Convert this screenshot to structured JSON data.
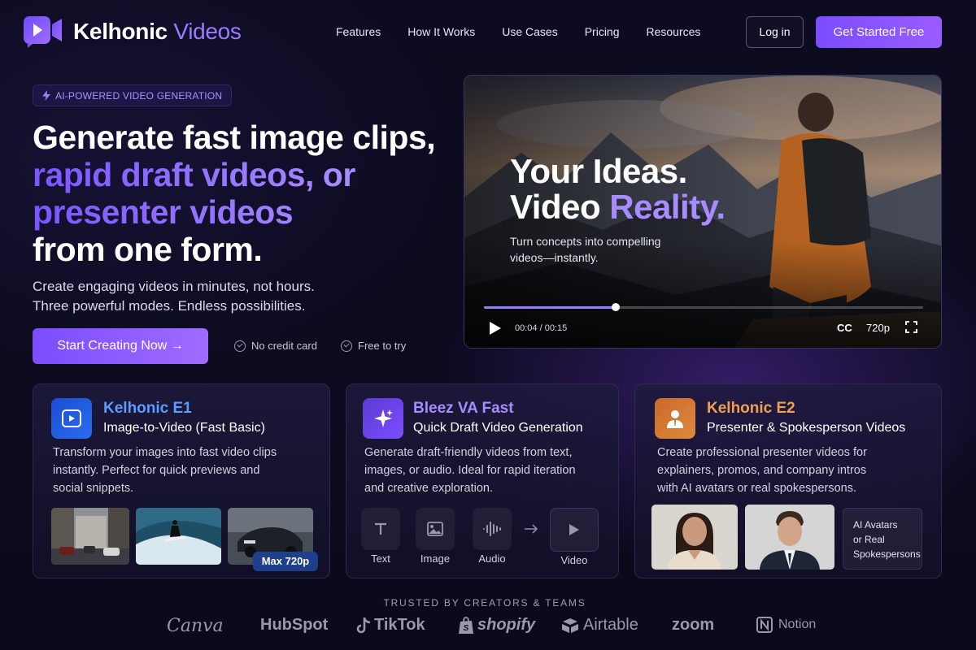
{
  "brand": {
    "name_a": "Kelhonic",
    "name_b": "Videos"
  },
  "nav": {
    "items": [
      "Features",
      "How It Works",
      "Use Cases",
      "Pricing",
      "Resources"
    ],
    "login": "Log in",
    "get_started": "Get Started Free"
  },
  "hero": {
    "badge": "AI-POWERED VIDEO GENERATION",
    "line1": "Generate fast image clips,",
    "line2": "rapid draft videos, or",
    "line3": "presenter videos",
    "line4": "from one form.",
    "sub1": "Create engaging videos in minutes, not hours.",
    "sub2": "Three powerful modes. Endless possibilities.",
    "cta": "Start Creating Now →",
    "check1": "No credit card",
    "check2": "Free to try"
  },
  "video": {
    "head1": "Your Ideas.",
    "head2a": "Video ",
    "head2b": "Reality.",
    "sub1": "Turn concepts into compelling",
    "sub2": "videos—instantly.",
    "time": "00:04 / 00:15",
    "progress": 0.3,
    "cc": "CC",
    "quality": "720p"
  },
  "cards": [
    {
      "name": "Kelhonic E1",
      "tag": "Image-to-Video (Fast Basic)",
      "desc": [
        "Transform your images into fast video clips",
        "instantly. Perfect for quick previews and",
        "social snippets."
      ],
      "max_badge": "Max 720p",
      "icon": "video-square-icon"
    },
    {
      "name": "Bleez VA Fast",
      "tag": "Quick Draft Video Generation",
      "desc": [
        "Generate draft-friendly videos from text,",
        "images, or audio. Ideal for rapid iteration",
        "and creative exploration."
      ],
      "modes": [
        "Text",
        "Image",
        "Audio",
        "Video"
      ],
      "icon": "sparkle-icon"
    },
    {
      "name": "Kelhonic E2",
      "tag": "Presenter & Spokesperson Videos",
      "desc": [
        "Create professional presenter videos for",
        "explainers, promos, and company intros",
        "with AI avatars or real spokespersons."
      ],
      "avatar_note": [
        "AI Avatars",
        "or Real",
        "Spokespersons"
      ],
      "icon": "presenter-icon"
    }
  ],
  "trusted": {
    "label": "TRUSTED BY CREATORS & TEAMS",
    "logos": [
      "Canva",
      "HubSpot",
      "TikTok",
      "shopify",
      "Airtable",
      "zoom",
      "Notion"
    ]
  },
  "colors": {
    "accent": "#8b5cf6",
    "bg": "#0c0a1f",
    "e2_name": "#f0a04b",
    "e1_name": "#5a9cff",
    "va_name": "#a78bff"
  }
}
